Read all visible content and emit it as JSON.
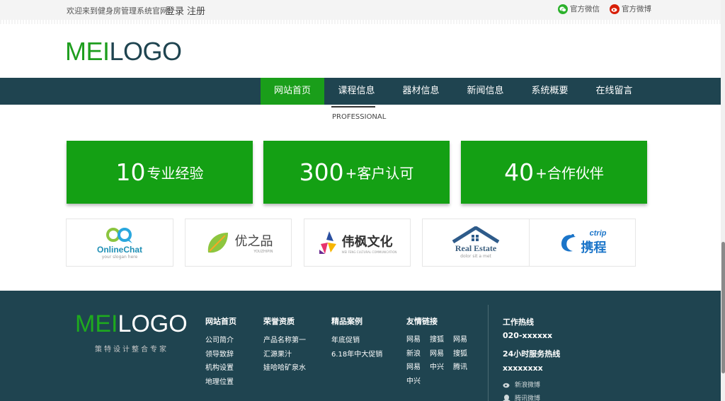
{
  "topbar": {
    "welcome": "欢迎来到健身房管理系统官网!",
    "login": "登录",
    "register": "注册",
    "wechat": "官方微信",
    "weibo": "官方微博",
    "wechat_color": "#2bb12b",
    "weibo_color": "#d81e06"
  },
  "logo": {
    "part1": "MEI",
    "part2": "LOGO"
  },
  "nav": {
    "items": [
      "网站首页",
      "课程信息",
      "器材信息",
      "新闻信息",
      "系统概要",
      "在线留言"
    ],
    "active_index": 0,
    "bg_color": "#1f4450",
    "active_color": "#1a9e1a"
  },
  "professional": "PROFESSIONAL",
  "stats": [
    {
      "number": "10",
      "label": "专业经验"
    },
    {
      "number": "300",
      "label": "+客户认可"
    },
    {
      "number": "40",
      "label": "+合作伙伴"
    }
  ],
  "partners": [
    {
      "name": "OnlineChat",
      "caption": "your slogan here",
      "icon": "chat-infinity-icon"
    },
    {
      "name": "优之品",
      "caption": "YOUZHIPIN",
      "icon": "leaf-icon"
    },
    {
      "name": "伟枫文化",
      "caption": "WEI FENG CULTURAL COMMUNICATION",
      "icon": "colorful-triangles-icon"
    },
    {
      "name": "Real Estate",
      "caption": "dolor sit a met",
      "icon": "house-roof-icon"
    },
    {
      "name": "携程",
      "caption": "ctrip",
      "icon": "dolphin-icon"
    }
  ],
  "footer": {
    "logo_part1": "MEI",
    "logo_part2": "LOGO",
    "tagline": "策特设计整合专家",
    "columns": [
      {
        "title": "网站首页",
        "links": [
          "公司简介",
          "领导致辞",
          "机构设置",
          "地理位置"
        ]
      },
      {
        "title": "荣誉资质",
        "links": [
          "产品名称第一",
          "汇源果汁",
          "娃哈哈矿泉水"
        ]
      },
      {
        "title": "精品案例",
        "links": [
          "年底促销",
          "6.18年中大促销"
        ]
      }
    ],
    "friend_links": {
      "title": "友情链接",
      "links": [
        "网易",
        "搜狐",
        "网易",
        "新浪",
        "网易",
        "搜狐",
        "网易",
        "中兴",
        "腾讯",
        "中兴"
      ]
    },
    "hotline_label": "工作热线",
    "hotline_number": "020-xxxxxx",
    "service_label": "24小时服务热线",
    "service_number": "xxxxxxxx",
    "sina_weibo": "新浪微博",
    "tencent_weibo": "腾讯微博"
  }
}
